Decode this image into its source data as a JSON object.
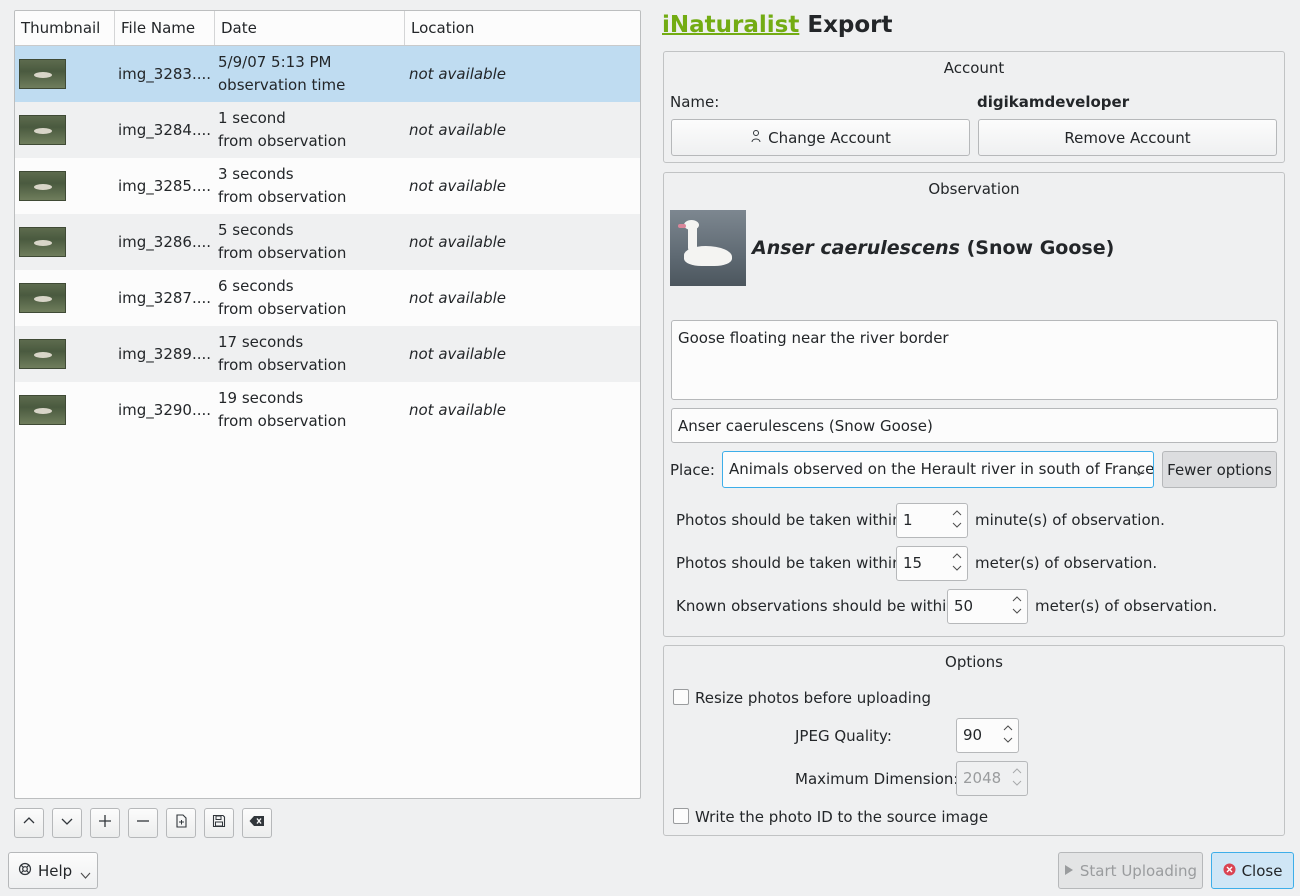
{
  "list": {
    "columns": [
      "Thumbnail",
      "File Name",
      "Date",
      "Location"
    ],
    "rows": [
      {
        "name": "img_3283....",
        "date_line1": "5/9/07 5:13 PM",
        "date_line2": "observation time",
        "location": "not available"
      },
      {
        "name": "img_3284....",
        "date_line1": "1 second",
        "date_line2": "from observation",
        "location": "not available"
      },
      {
        "name": "img_3285....",
        "date_line1": "3 seconds",
        "date_line2": "from observation",
        "location": "not available"
      },
      {
        "name": "img_3286....",
        "date_line1": "5 seconds",
        "date_line2": "from observation",
        "location": "not available"
      },
      {
        "name": "img_3287....",
        "date_line1": "6 seconds",
        "date_line2": "from observation",
        "location": "not available"
      },
      {
        "name": "img_3289....",
        "date_line1": "17 seconds",
        "date_line2": "from observation",
        "location": "not available"
      },
      {
        "name": "img_3290....",
        "date_line1": "19 seconds",
        "date_line2": "from observation",
        "location": "not available"
      }
    ],
    "tools": [
      "chevron-up-icon",
      "chevron-down-icon",
      "plus-icon",
      "minus-icon",
      "load-list-icon",
      "save-list-icon",
      "clear-list-icon"
    ]
  },
  "title": {
    "brand": "iNaturalist",
    "rest": " Export"
  },
  "account": {
    "title": "Account",
    "name_label": "Name:",
    "name_value": "digikamdeveloper",
    "change_label": "Change Account",
    "remove_label": "Remove Account"
  },
  "observation": {
    "title": "Observation",
    "species_latin": "Anser caerulescens",
    "species_common": " (Snow Goose)",
    "description": "Goose floating near the river border",
    "taxon_field": "Anser caerulescens (Snow Goose)",
    "place_label": "Place:",
    "place_value": "Animals observed on the Herault river in south of France",
    "fewer_options": "Fewer options",
    "time_label": "Photos should be taken within",
    "time_value": "1",
    "time_unit": "minute(s) of observation.",
    "dist_label": "Photos should be taken within",
    "dist_value": "15",
    "dist_unit": "meter(s) of observation.",
    "known_label": "Known observations should be within",
    "known_value": "50",
    "known_unit": "meter(s) of observation."
  },
  "options": {
    "title": "Options",
    "resize_label": "Resize photos before uploading",
    "jpeg_label": "JPEG Quality:",
    "jpeg_value": "90",
    "maxdim_label": "Maximum Dimension:",
    "maxdim_value": "2048",
    "photo_id_label": "Write the photo ID to the source image"
  },
  "footer": {
    "help": "Help",
    "start_upload": "Start Uploading",
    "close": "Close"
  },
  "colors": {
    "accent": "#3daee9",
    "brand": "#73ac13",
    "selection": "#bfdcf1",
    "close_icon": "#da4453"
  }
}
